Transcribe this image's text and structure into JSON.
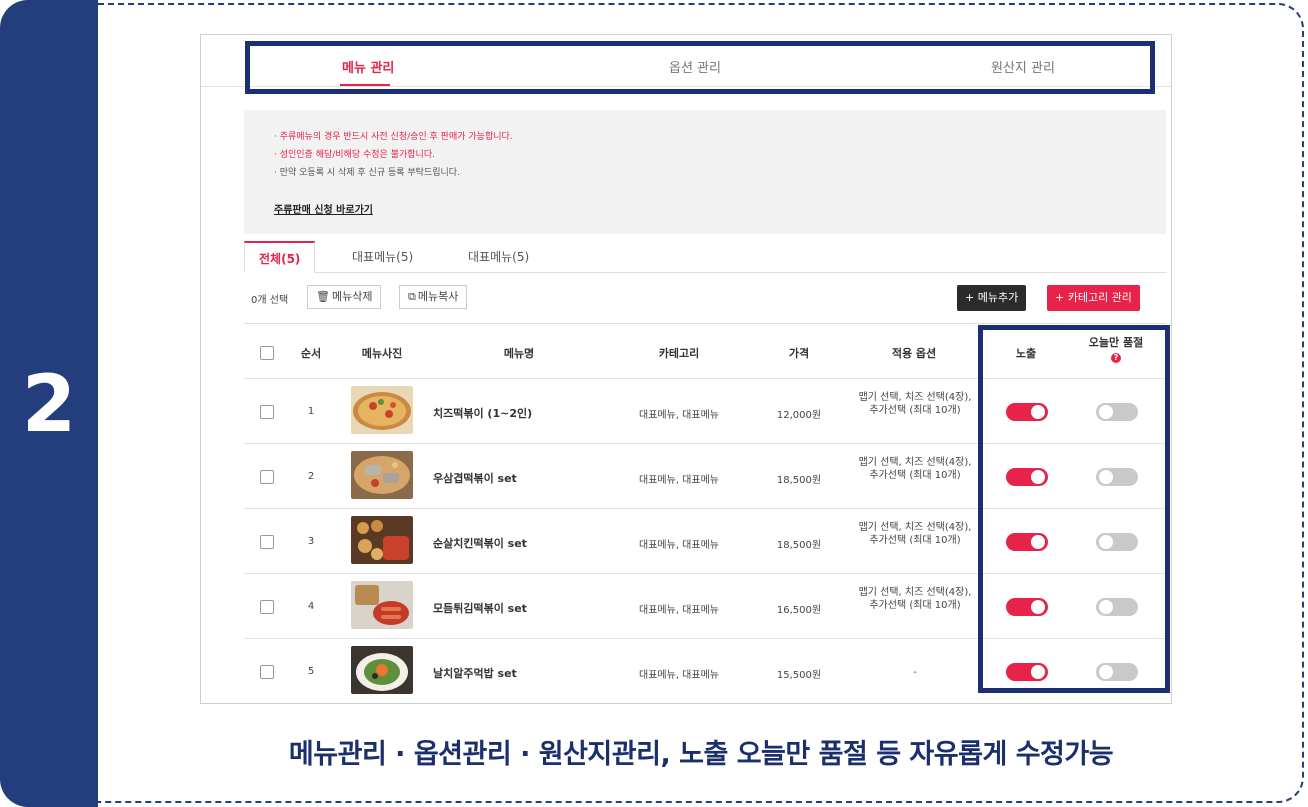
{
  "step_number": "2",
  "top_tabs": [
    {
      "label": "메뉴 관리",
      "active": true
    },
    {
      "label": "옵션 관리",
      "active": false
    },
    {
      "label": "원산지 관리",
      "active": false
    }
  ],
  "notice": {
    "lines": [
      "· 주류메뉴의 경우 반드시 사전 신청/승인 후 판매가 가능합니다.",
      "· 성인인증 해당/비해당 수정은 불가합니다.",
      "· 만약 오등록 시 삭제 후 신규 등록 부탁드립니다."
    ],
    "link": "주류판매 신청 바로가기"
  },
  "sub_tabs": [
    {
      "label": "전체(5)",
      "active": true
    },
    {
      "label": "대표메뉴(5)",
      "active": false
    },
    {
      "label": "대표메뉴(5)",
      "active": false
    }
  ],
  "toolbar": {
    "selected_count": "0개 선택",
    "delete_label": "메뉴삭제",
    "copy_label": "메뉴복사",
    "add_menu_label": "+ 메뉴추가",
    "category_label": "+ 카테고리 관리"
  },
  "table": {
    "headers": {
      "order": "순서",
      "photo": "메뉴사진",
      "name": "메뉴명",
      "category": "카테고리",
      "price": "가격",
      "options": "적용 옵션",
      "visible": "노출",
      "soldout_today": "오늘만 품절"
    },
    "rows": [
      {
        "order": "1",
        "name": "치즈떡볶이 (1~2인)",
        "category": "대표메뉴, 대표메뉴",
        "price": "12,000원",
        "options": "맵기 선택, 치즈 선택(4장), 추가선택 (최대 10개)",
        "visible": true,
        "soldout": false
      },
      {
        "order": "2",
        "name": "우삼겹떡볶이 set",
        "category": "대표메뉴, 대표메뉴",
        "price": "18,500원",
        "options": "맵기 선택, 치즈 선택(4장), 추가선택 (최대 10개)",
        "visible": true,
        "soldout": false
      },
      {
        "order": "3",
        "name": "순살치킨떡볶이 set",
        "category": "대표메뉴, 대표메뉴",
        "price": "18,500원",
        "options": "맵기 선택, 치즈 선택(4장), 추가선택 (최대 10개)",
        "visible": true,
        "soldout": false
      },
      {
        "order": "4",
        "name": "모듬튀김떡볶이 set",
        "category": "대표메뉴, 대표메뉴",
        "price": "16,500원",
        "options": "맵기 선택, 치즈 선택(4장), 추가선택 (최대 10개)",
        "visible": true,
        "soldout": false
      },
      {
        "order": "5",
        "name": "날치알주먹밥 set",
        "category": "대표메뉴, 대표메뉴",
        "price": "15,500원",
        "options": "-",
        "visible": true,
        "soldout": false
      }
    ]
  },
  "caption": "메뉴관리 · 옵션관리 · 원산지관리, 노출 오늘만 품절 등  자유롭게 수정가능",
  "colors": {
    "accent": "#e8234a",
    "navy": "#243d7d",
    "highlight": "#1c2f73"
  },
  "icons": {
    "delete": "trash-icon",
    "copy": "copy-icon",
    "help": "question-icon"
  }
}
